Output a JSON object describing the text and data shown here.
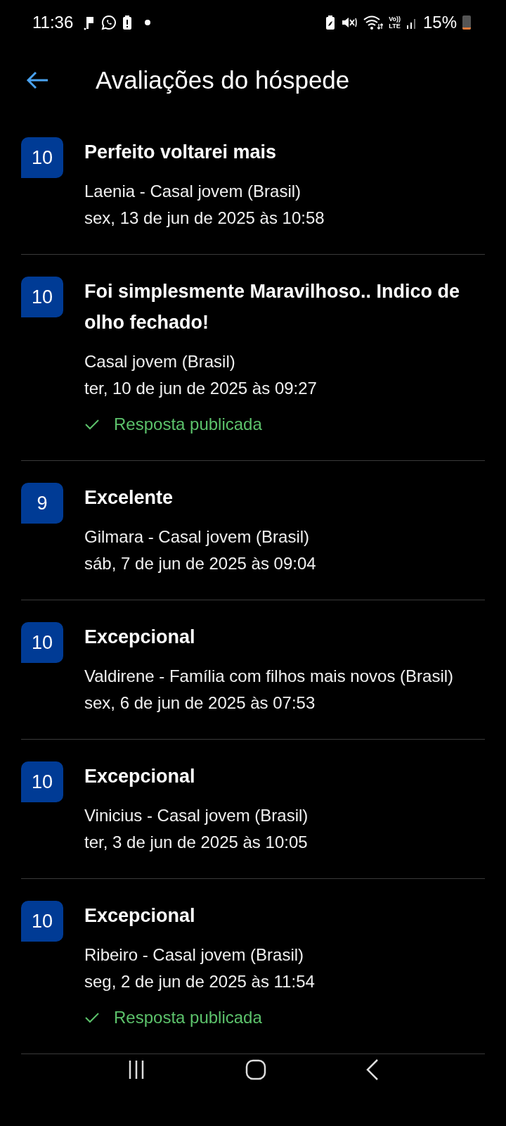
{
  "status_bar": {
    "time": "11:36",
    "volte_top": "Vo))",
    "volte_bottom": "LTE",
    "battery": "15%"
  },
  "header": {
    "title": "Avaliações do hóspede"
  },
  "reviews": [
    {
      "score": "10",
      "title": "Perfeito voltarei mais",
      "author": "Laenia - Casal jovem (Brasil)",
      "date": "sex, 13 de jun de 2025 às 10:58"
    },
    {
      "score": "10",
      "title": "Foi simplesmente Maravilhoso.. Indico de olho fechado!",
      "author": "Casal jovem (Brasil)",
      "date": "ter, 10 de jun de 2025 às 09:27",
      "reply": "Resposta publicada"
    },
    {
      "score": "9",
      "title": "Excelente",
      "author": "Gilmara - Casal jovem (Brasil)",
      "date": "sáb, 7 de jun de 2025 às 09:04"
    },
    {
      "score": "10",
      "title": "Excepcional",
      "author": "Valdirene - Família com filhos mais novos (Brasil)",
      "date": "sex, 6 de jun de 2025 às 07:53"
    },
    {
      "score": "10",
      "title": "Excepcional",
      "author": "Vinicius - Casal jovem (Brasil)",
      "date": "ter, 3 de jun de 2025 às 10:05"
    },
    {
      "score": "10",
      "title": "Excepcional",
      "author": "Ribeiro - Casal jovem (Brasil)",
      "date": "seg, 2 de jun de 2025 às 11:54",
      "reply": "Resposta publicada"
    }
  ]
}
